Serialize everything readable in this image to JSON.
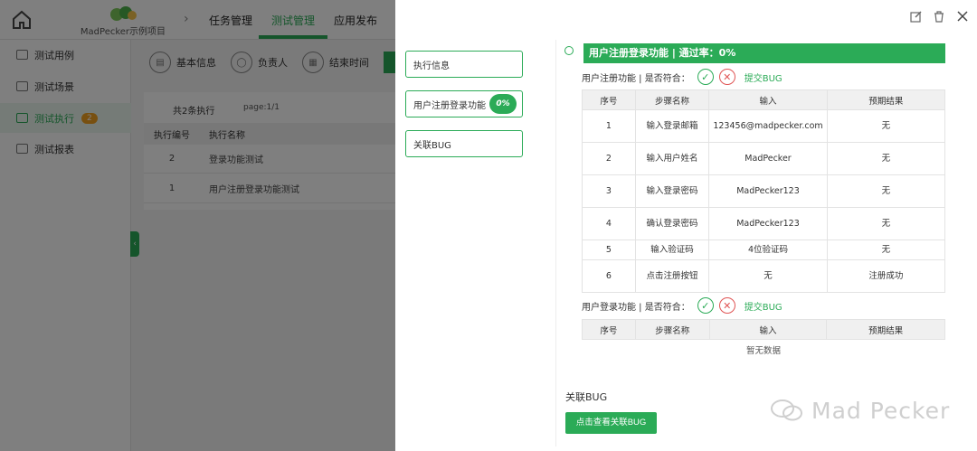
{
  "app": {
    "logo_text": "MadPecker示例项目",
    "nav": [
      "任务管理",
      "测试管理",
      "应用发布"
    ],
    "nav_active": 1
  },
  "sidebar": {
    "items": [
      {
        "label": "测试用例"
      },
      {
        "label": "测试场景"
      },
      {
        "label": "测试执行",
        "badge": "2"
      },
      {
        "label": "测试报表"
      }
    ],
    "active": 2
  },
  "main": {
    "tabs": [
      "基本信息",
      "负责人",
      "结束时间"
    ],
    "count_text": "共2条执行",
    "page_text": "page:1/1",
    "columns": [
      "执行编号",
      "执行名称"
    ],
    "rows": [
      {
        "id": "2",
        "name": "登录功能测试"
      },
      {
        "id": "1",
        "name": "用户注册登录功能测试"
      }
    ]
  },
  "drawer": {
    "side_buttons": [
      {
        "label": "执行信息"
      },
      {
        "label": "用户注册登录功能",
        "badge": "0%"
      },
      {
        "label": "关联BUG"
      }
    ],
    "section_title": "用户注册登录功能 | 通过率：0%",
    "function_blocks": [
      {
        "label": "用户注册功能 | 是否符合：",
        "submit_bug": "提交BUG",
        "columns": [
          "序号",
          "步骤名称",
          "输入",
          "预期结果"
        ],
        "rows": [
          {
            "no": "1",
            "step": "输入登录邮箱",
            "input": "123456@madpecker.com",
            "expected": "无"
          },
          {
            "no": "2",
            "step": "输入用户姓名",
            "input": "MadPecker",
            "expected": "无"
          },
          {
            "no": "3",
            "step": "输入登录密码",
            "input": "MadPecker123",
            "expected": "无"
          },
          {
            "no": "4",
            "step": "确认登录密码",
            "input": "MadPecker123",
            "expected": "无"
          },
          {
            "no": "5",
            "step": "输入验证码",
            "input": "4位验证码",
            "expected": "无"
          },
          {
            "no": "6",
            "step": "点击注册按钮",
            "input": "无",
            "expected": "注册成功"
          }
        ]
      },
      {
        "label": "用户登录功能 | 是否符合：",
        "submit_bug": "提交BUG",
        "columns": [
          "序号",
          "步骤名称",
          "输入",
          "预期结果"
        ],
        "empty_text": "暂无数据"
      }
    ],
    "related_bug_label": "关联BUG",
    "view_bug_button": "点击查看关联BUG"
  },
  "watermark": "Mad Pecker",
  "colors": {
    "accent": "#2bab57",
    "danger": "#e05454",
    "badge": "#f0a020"
  }
}
